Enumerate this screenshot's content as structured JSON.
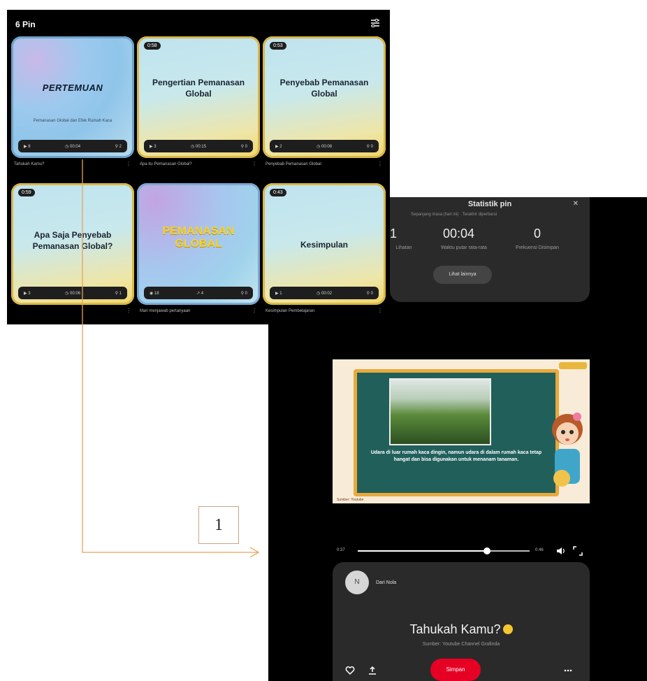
{
  "pins_panel": {
    "header": "6 Pin",
    "cards": [
      {
        "badge": "",
        "title": "PERTEMUAN",
        "subtitle": "Pemanasan Global dan Efek Rumah Kaca",
        "stats": [
          "8",
          "00:04",
          "2"
        ],
        "caption": "Tahukah Kamu?"
      },
      {
        "badge": "0:58",
        "title": "Pengertian Pemanasan Global",
        "subtitle": "",
        "stats": [
          "3",
          "00:15",
          "0"
        ],
        "caption": "Apa itu Pemanasan Global?"
      },
      {
        "badge": "0:53",
        "title": "Penyebab Pemanasan Global",
        "subtitle": "",
        "stats": [
          "2",
          "00:08",
          "0"
        ],
        "caption": "Penyebab Pemanasan Global"
      },
      {
        "badge": "0:59",
        "title": "Apa Saja Penyebab Pemanasan Global?",
        "subtitle": "",
        "stats": [
          "3",
          "00:06",
          "1"
        ],
        "caption": ""
      },
      {
        "badge": "",
        "title": "PEMANASAN GLOBAL",
        "subtitle": "",
        "stats": [
          "18",
          "4",
          "0"
        ],
        "caption": "Mari menjawab pertanyaan"
      },
      {
        "badge": "0:43",
        "title": "Kesimpulan",
        "subtitle": "",
        "stats": [
          "1",
          "00:02",
          "0"
        ],
        "caption": "Kesimpulan Pembelajaran"
      }
    ]
  },
  "stats": {
    "title": "Statistik pin",
    "subtitle": "Sepanjang masa (hari ini) · Terakhir diperbarui",
    "items": [
      {
        "value": "1",
        "label": "Lihatan"
      },
      {
        "value": "00:04",
        "label": "Waktu putar rata-rata"
      },
      {
        "value": "0",
        "label": "Frekuensi Disimpan"
      }
    ],
    "button": "Lihat lainnya"
  },
  "video": {
    "text": "Udara di luar rumah kaca dingin, namun udara di dalam rumah kaca tetap hangat dan bisa digunakan untuk menanam tanaman.",
    "caption": "Sumber: Youtube",
    "progress": 0.75
  },
  "player": {
    "current_time": "0:37",
    "duration": "0:46"
  },
  "pin_info": {
    "avatar_initials": "N",
    "author": "Dari Nola",
    "title": "Tahukah Kamu?",
    "source": "Sumber: Youtube Channel Grafinda",
    "save_label": "Simpan"
  },
  "annotation": {
    "label": "1"
  },
  "colors": {
    "save_red": "#e60023",
    "arrow": "#e8a35c",
    "card_border": "#d8b84a"
  }
}
